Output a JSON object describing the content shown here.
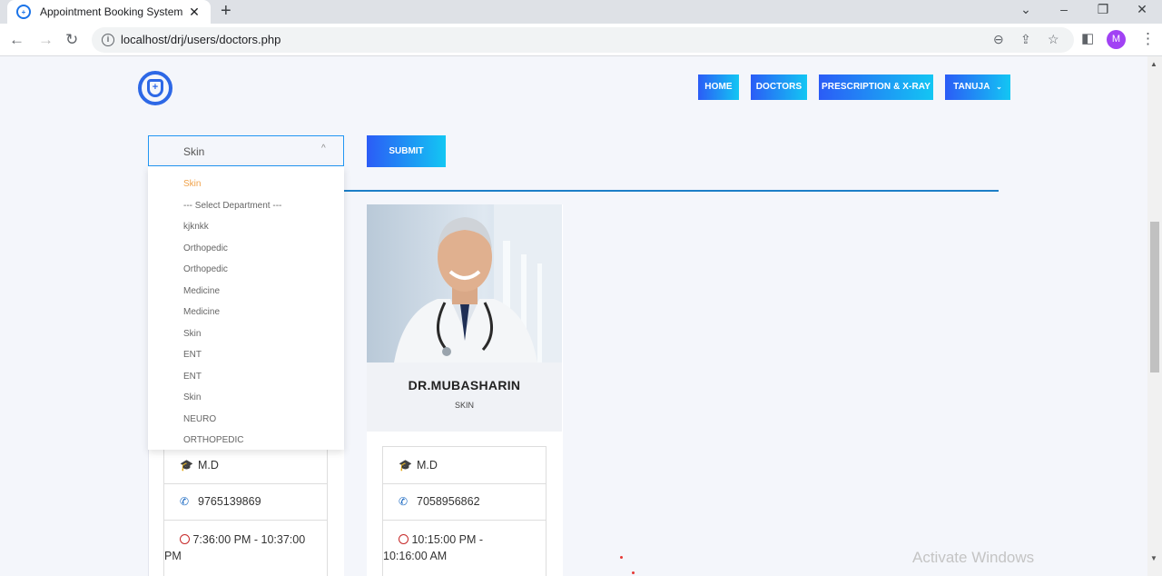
{
  "browser": {
    "tab_title": "Appointment Booking System",
    "url": "localhost/drj/users/doctors.php",
    "avatar_letter": "M"
  },
  "nav": {
    "home": "HOME",
    "doctors": "DOCTORS",
    "prescription": "PRESCRIPTION & X-RAY",
    "user": "TANUJA"
  },
  "filter": {
    "selected": "Skin",
    "submit_label": "SUBMIT",
    "options": [
      "Skin",
      "--- Select Department ---",
      "kjknkk",
      "Orthopedic",
      "Orthopedic",
      "Medicine",
      "Medicine",
      "Skin",
      "ENT",
      "ENT",
      "Skin",
      "NEURO",
      "ORTHOPEDIC"
    ]
  },
  "doctors": [
    {
      "qualification": "M.D",
      "phone": "9765139869",
      "time_line1": "7:36:00 PM - 10:37:00",
      "time_line2": "PM"
    },
    {
      "name": "DR.MUBASHARIN",
      "department": "SKIN",
      "qualification": "M.D",
      "phone": "7058956862",
      "time_line1": "10:15:00 PM -",
      "time_line2": "10:16:00 AM"
    }
  ],
  "watermark": "Activate Windows",
  "colors": {
    "accent_gradient_start": "#2b5cf6",
    "accent_gradient_end": "#13c6f3",
    "divider": "#1c7fc7",
    "dropdown_active": "#f0a24a"
  }
}
